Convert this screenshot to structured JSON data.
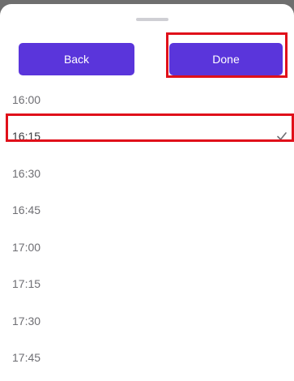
{
  "sheet": {
    "back_label": "Back",
    "done_label": "Done"
  },
  "times": [
    {
      "label": "16:00",
      "selected": false
    },
    {
      "label": "16:15",
      "selected": true
    },
    {
      "label": "16:30",
      "selected": false
    },
    {
      "label": "16:45",
      "selected": false
    },
    {
      "label": "17:00",
      "selected": false
    },
    {
      "label": "17:15",
      "selected": false
    },
    {
      "label": "17:30",
      "selected": false
    },
    {
      "label": "17:45",
      "selected": false
    }
  ],
  "colors": {
    "accent": "#5a35db",
    "highlight": "#e0101a"
  },
  "icons": {
    "selected_marker": "checkmark-icon"
  }
}
